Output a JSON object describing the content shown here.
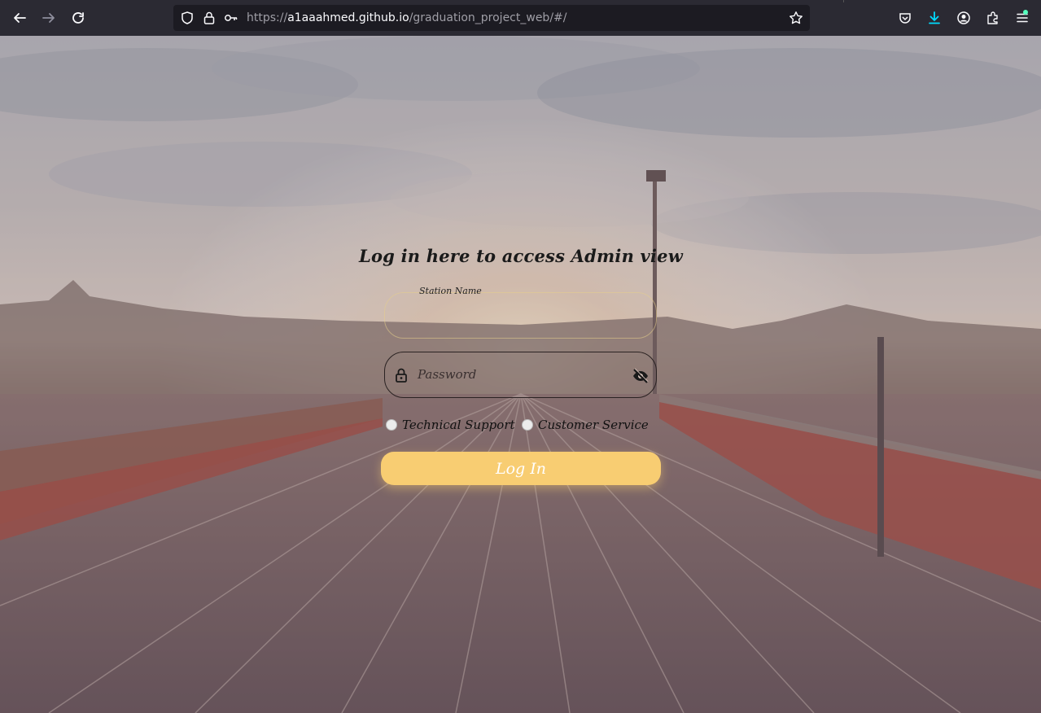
{
  "browser": {
    "url_scheme": "https://",
    "url_host": "a1aaahmed.github.io",
    "url_path": "/graduation_project_web/#/"
  },
  "login": {
    "heading": "Log in here to access Admin view",
    "station_label": "Station Name",
    "station_value": "",
    "password_placeholder": "Password",
    "roles": [
      {
        "label": "Technical Support",
        "selected": false
      },
      {
        "label": "Customer Service",
        "selected": false
      }
    ],
    "login_button": "Log In"
  },
  "colors": {
    "button": "#f8cd72",
    "chrome": "#2b2a33"
  },
  "icons": [
    "back-arrow-icon",
    "forward-arrow-icon",
    "reload-icon",
    "shield-icon",
    "lock-icon",
    "key-icon",
    "star-icon",
    "pocket-icon",
    "download-icon",
    "account-icon",
    "extensions-icon",
    "menu-icon",
    "padlock-icon",
    "eye-slash-icon"
  ]
}
